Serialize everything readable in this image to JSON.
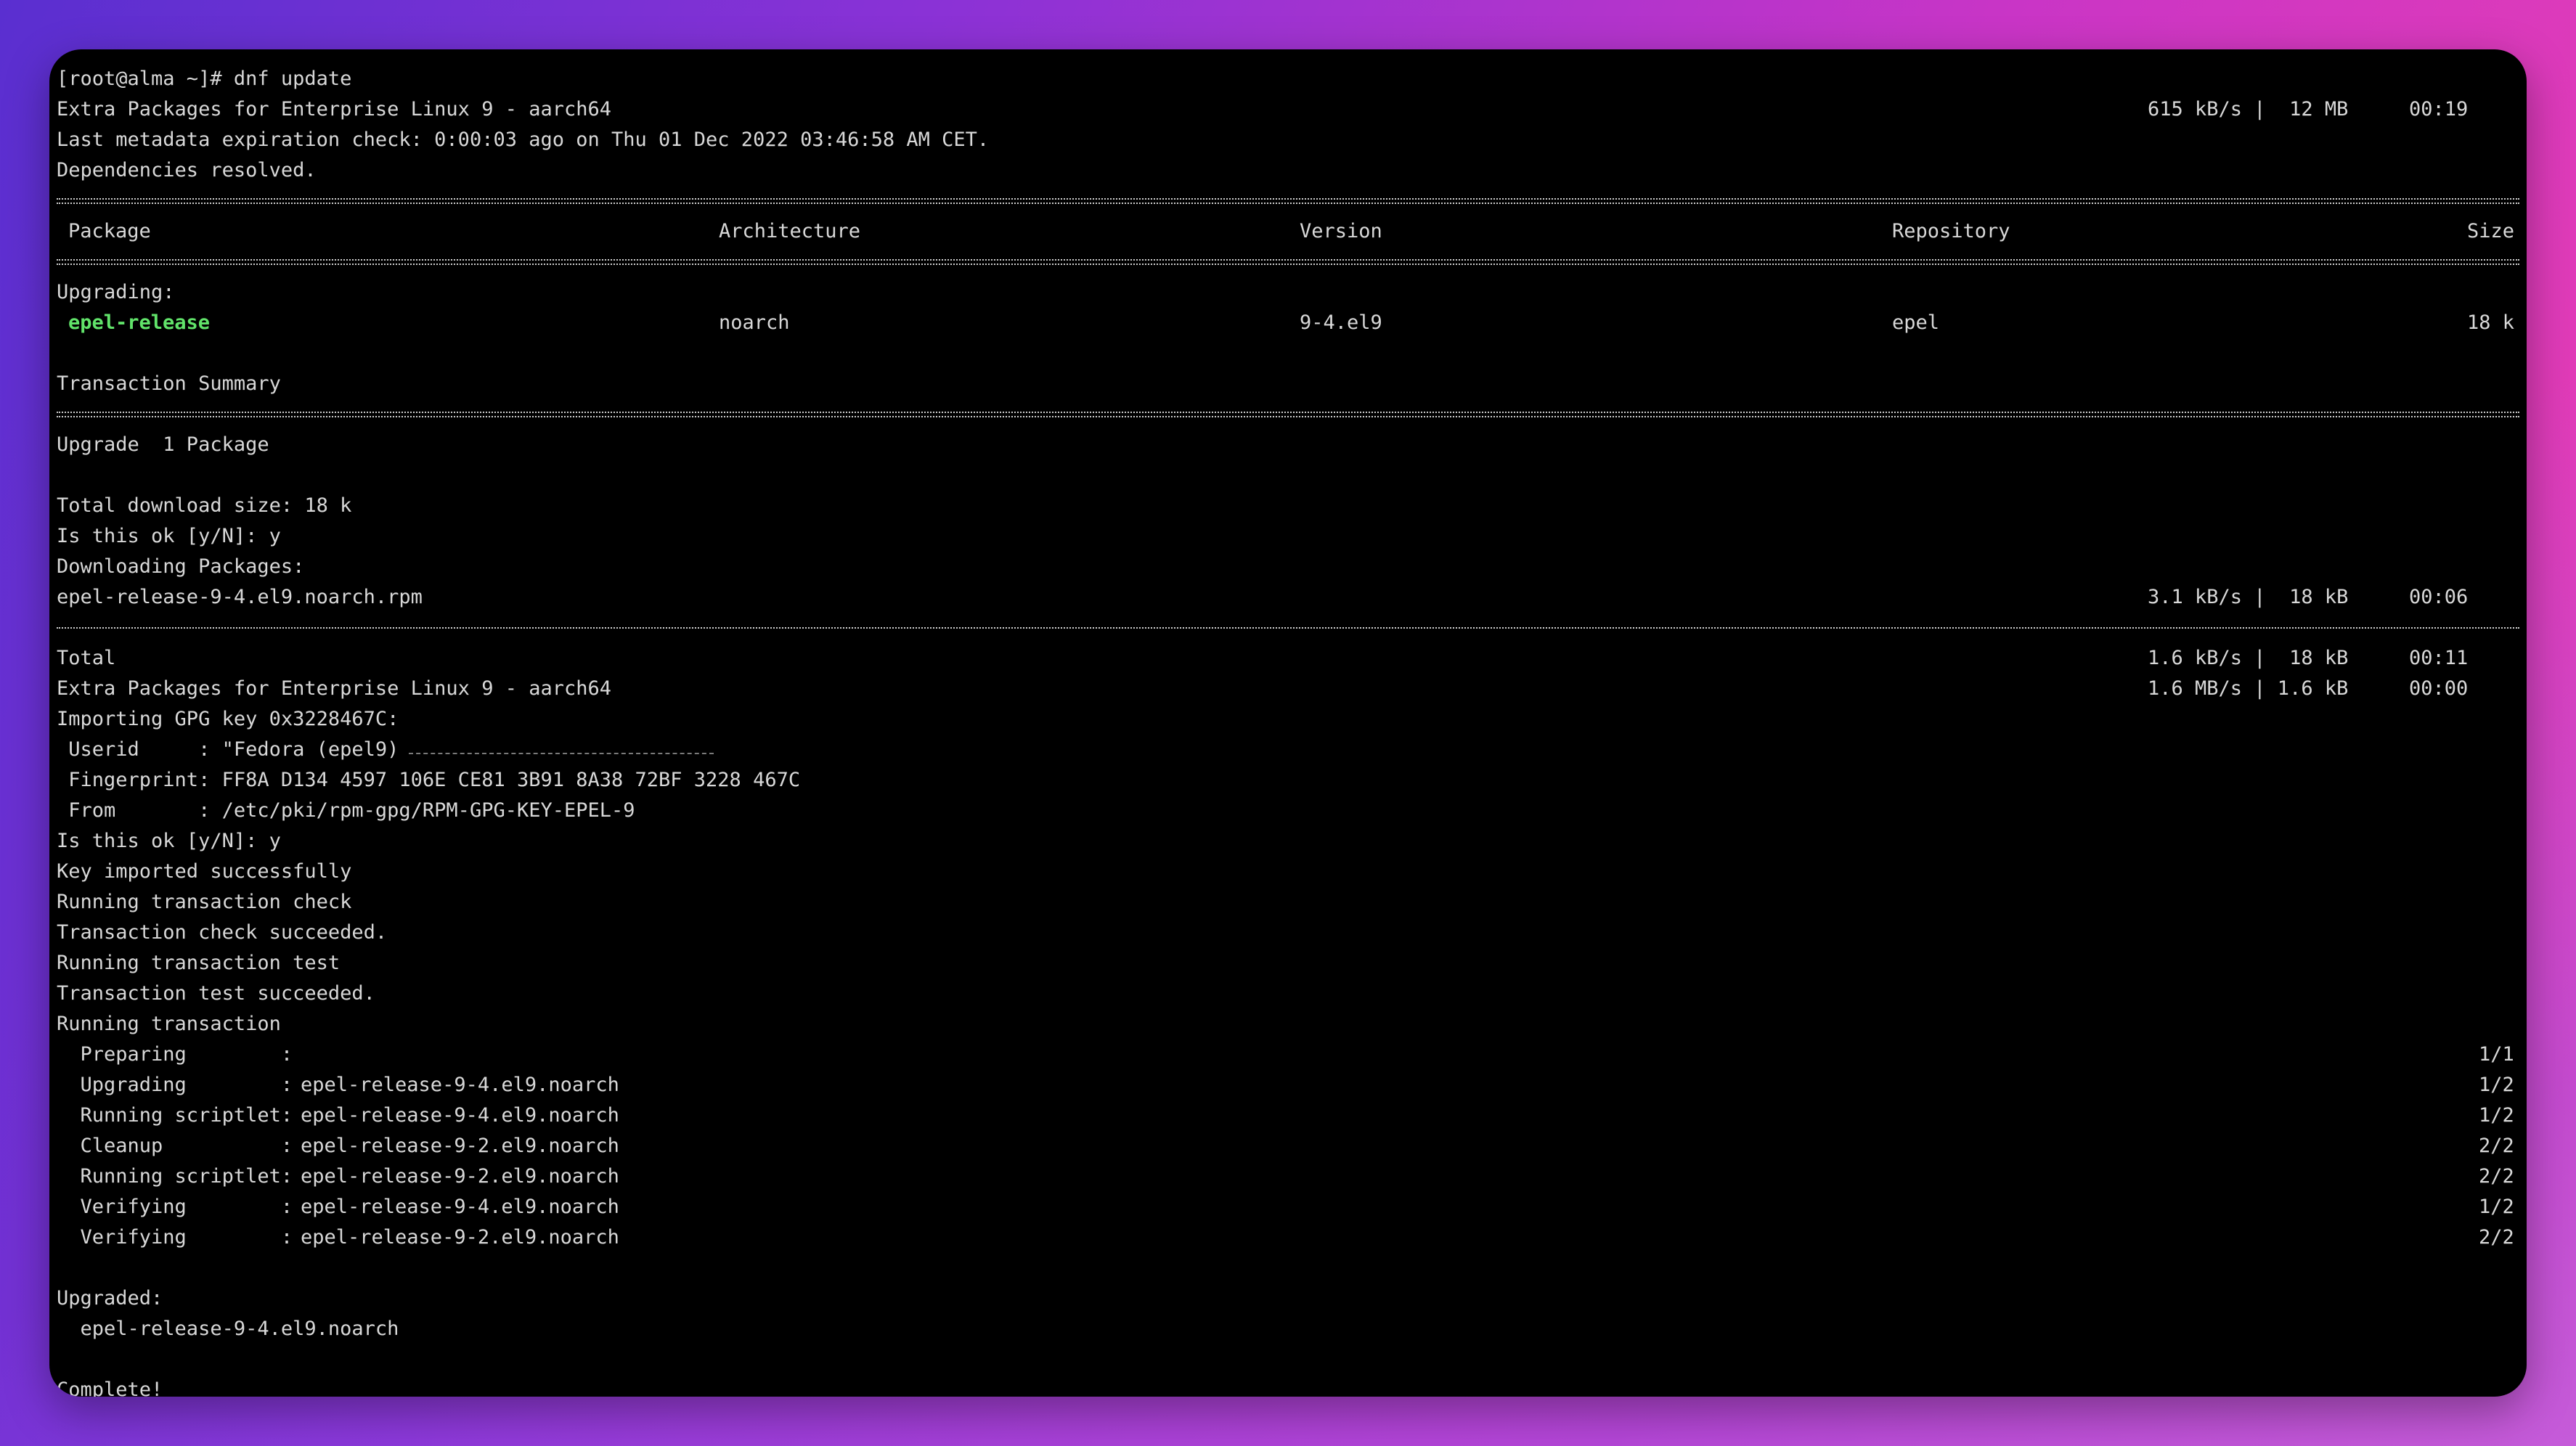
{
  "terminal": {
    "prompt_line": "[root@alma ~]# dnf update",
    "repo_line": {
      "text": "Extra Packages for Enterprise Linux 9 - aarch64",
      "speed": "615 kB/s |  12 MB",
      "time": "00:19"
    },
    "metadata_line": "Last metadata expiration check: 0:00:03 ago on Thu 01 Dec 2022 03:46:58 AM CET.",
    "deps_line": "Dependencies resolved.",
    "table": {
      "headers": {
        "package": "Package",
        "architecture": "Architecture",
        "version": "Version",
        "repository": "Repository",
        "size": "Size"
      },
      "section_label": "Upgrading:",
      "row": {
        "package": "epel-release",
        "architecture": "noarch",
        "version": "9-4.el9",
        "repository": "epel",
        "size": "18 k"
      }
    },
    "summary_title": "Transaction Summary",
    "upgrade_line": "Upgrade  1 Package",
    "total_download": "Total download size: 18 k",
    "confirm_1": "Is this ok [y/N]: y",
    "downloading": "Downloading Packages:",
    "download_row": {
      "file": "epel-release-9-4.el9.noarch.rpm",
      "speed": "3.1 kB/s |  18 kB",
      "time": "00:06"
    },
    "total_row": {
      "label": "Total",
      "speed": "1.6 kB/s |  18 kB",
      "time": "00:11"
    },
    "repo_line_2": {
      "text": "Extra Packages for Enterprise Linux 9 - aarch64",
      "speed": "1.6 MB/s | 1.6 kB",
      "time": "00:00"
    },
    "gpg_import": "Importing GPG key 0x3228467C:",
    "userid": " Userid     : \"Fedora (epel9)",
    "fingerprint": " Fingerprint: FF8A D134 4597 106E CE81 3B91 8A38 72BF 3228 467C",
    "from": " From       : /etc/pki/rpm-gpg/RPM-GPG-KEY-EPEL-9",
    "confirm_2": "Is this ok [y/N]: y",
    "key_imported": "Key imported successfully",
    "check_running": "Running transaction check",
    "check_ok": "Transaction check succeeded.",
    "test_running": "Running transaction test",
    "test_ok": "Transaction test succeeded.",
    "running": "Running transaction",
    "steps": [
      {
        "label": "  Preparing        :",
        "target": "",
        "count": "1/1"
      },
      {
        "label": "  Upgrading        :",
        "target": "epel-release-9-4.el9.noarch",
        "count": "1/2"
      },
      {
        "label": "  Running scriptlet:",
        "target": "epel-release-9-4.el9.noarch",
        "count": "1/2"
      },
      {
        "label": "  Cleanup          :",
        "target": "epel-release-9-2.el9.noarch",
        "count": "2/2"
      },
      {
        "label": "  Running scriptlet:",
        "target": "epel-release-9-2.el9.noarch",
        "count": "2/2"
      },
      {
        "label": "  Verifying        :",
        "target": "epel-release-9-4.el9.noarch",
        "count": "1/2"
      },
      {
        "label": "  Verifying        :",
        "target": "epel-release-9-2.el9.noarch",
        "count": "2/2"
      }
    ],
    "upgraded_title": "Upgraded:",
    "upgraded_pkg": "  epel-release-9-4.el9.noarch",
    "complete": "Complete!",
    "colors": {
      "text": "#d8d8d8",
      "highlight": "#61e36a",
      "background": "#000000"
    }
  }
}
